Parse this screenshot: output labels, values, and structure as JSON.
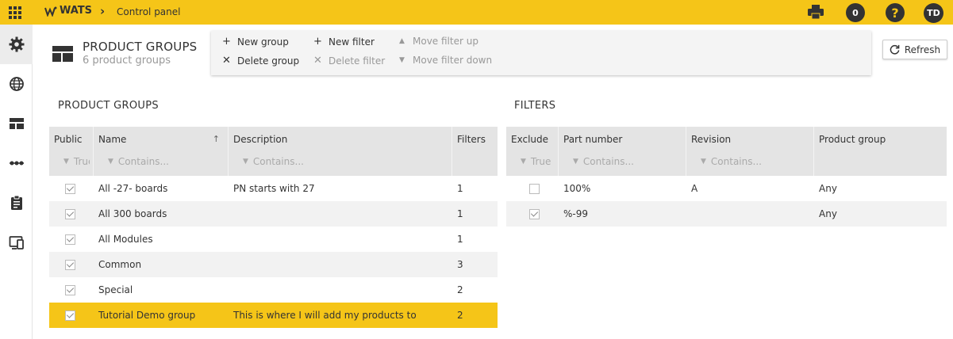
{
  "app": {
    "name": "WATS",
    "breadcrumb": "Control panel"
  },
  "topbar": {
    "notifications": "0",
    "help": "?",
    "avatar": "TD"
  },
  "page": {
    "title": "PRODUCT GROUPS",
    "subtitle": "6 product groups"
  },
  "toolbar": {
    "new_group": "New group",
    "delete_group": "Delete group",
    "new_filter": "New filter",
    "delete_filter": "Delete filter",
    "move_up": "Move filter up",
    "move_down": "Move filter down"
  },
  "refresh_label": "Refresh",
  "groups": {
    "title": "PRODUCT GROUPS",
    "columns": {
      "public": "Public",
      "name": "Name",
      "description": "Description",
      "filters": "Filters"
    },
    "filters": {
      "public": "True",
      "name": "Contains...",
      "description": "Contains..."
    },
    "rows": [
      {
        "public": true,
        "name": "All -27- boards",
        "description": "PN starts with 27",
        "filters": "1"
      },
      {
        "public": true,
        "name": "All 300 boards",
        "description": "",
        "filters": "1"
      },
      {
        "public": true,
        "name": "All Modules",
        "description": "",
        "filters": "1"
      },
      {
        "public": true,
        "name": "Common",
        "description": "",
        "filters": "3"
      },
      {
        "public": true,
        "name": "Special",
        "description": "",
        "filters": "2"
      },
      {
        "public": true,
        "name": "Tutorial Demo group",
        "description": "This is where I will add my products to",
        "filters": "2",
        "selected": true
      }
    ]
  },
  "filters": {
    "title": "FILTERS",
    "columns": {
      "exclude": "Exclude",
      "part_number": "Part number",
      "revision": "Revision",
      "product_group": "Product group"
    },
    "filters": {
      "exclude": "True",
      "part_number": "Contains...",
      "revision": "Contains..."
    },
    "rows": [
      {
        "exclude": false,
        "part_number": "100%",
        "revision": "A",
        "product_group": "Any"
      },
      {
        "exclude": true,
        "part_number": "%-99",
        "revision": "",
        "product_group": "Any"
      }
    ]
  },
  "colors": {
    "accent": "#f5c518",
    "header_bg": "#e4e4e4",
    "dark": "#333333"
  }
}
